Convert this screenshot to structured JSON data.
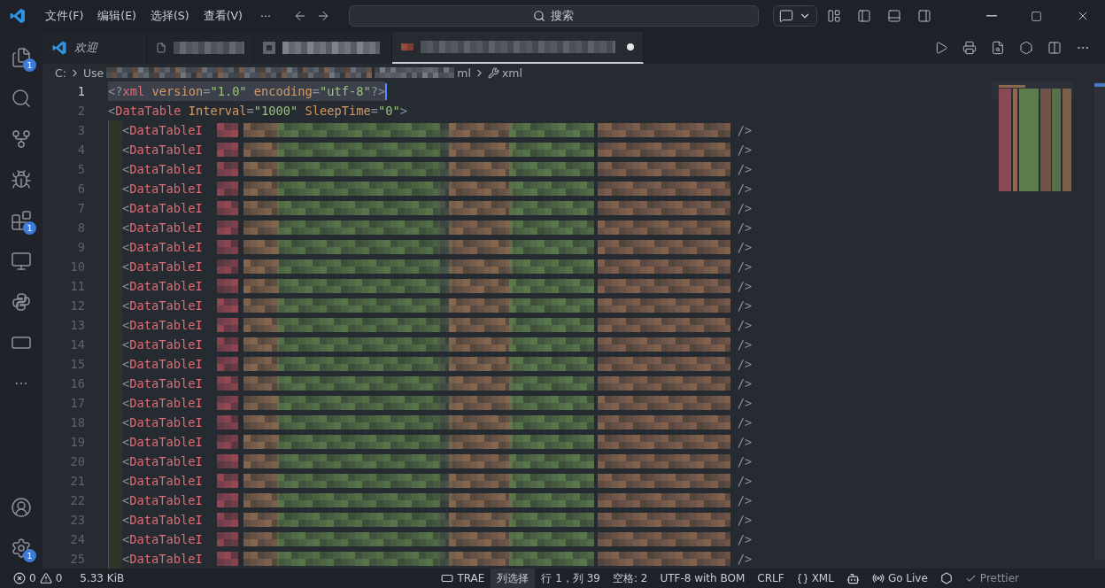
{
  "title_bar": {
    "menus": [
      "文件(F)",
      "编辑(E)",
      "选择(S)",
      "查看(V)"
    ],
    "overflow": "···",
    "command_center": "搜索"
  },
  "activity_bar": {
    "items": [
      {
        "kind": "explorer",
        "badge": "1"
      },
      {
        "kind": "search"
      },
      {
        "kind": "source_control"
      },
      {
        "kind": "debug"
      },
      {
        "kind": "extensions",
        "badge": "1"
      },
      {
        "kind": "remote"
      },
      {
        "kind": "python"
      },
      {
        "kind": "trae"
      },
      {
        "kind": "more",
        "label": "···"
      }
    ],
    "bottom": [
      {
        "kind": "account"
      },
      {
        "kind": "settings",
        "badge": "1"
      }
    ]
  },
  "tabs": [
    {
      "label": "欢迎",
      "selected": false,
      "modified": false
    },
    {
      "selected": false,
      "modified": false
    },
    {
      "selected": false,
      "modified": false
    },
    {
      "selected": true,
      "modified": true
    }
  ],
  "breadcrumb": [
    {
      "text": "C:",
      "kind": "plain"
    },
    {
      "text": "Use",
      "kind": "redacted_head"
    },
    {
      "text": "ml",
      "kind": "redacted_tail"
    },
    {
      "text": "xml",
      "kind": "symbol"
    }
  ],
  "editor": {
    "lines": [
      {
        "number": "1",
        "current": true,
        "tokens": [
          {
            "t": "<?",
            "kind": "punct"
          },
          {
            "t": "xml",
            "kind": "tag"
          },
          {
            "t": " version",
            "kind": "attr"
          },
          {
            "t": "=",
            "kind": "punct"
          },
          {
            "t": "\"1.0\"",
            "kind": "string"
          },
          {
            "t": " encoding",
            "kind": "attr"
          },
          {
            "t": "=",
            "kind": "punct"
          },
          {
            "t": "\"utf-8\"",
            "kind": "string"
          },
          {
            "t": "?>",
            "kind": "punct"
          }
        ]
      },
      {
        "number": "2",
        "current": false,
        "tokens": [
          {
            "t": "<",
            "kind": "punct"
          },
          {
            "t": "DataTable",
            "kind": "tag"
          },
          {
            "t": " Interval",
            "kind": "attr"
          },
          {
            "t": "=",
            "kind": "punct"
          },
          {
            "t": "\"1000\"",
            "kind": "string"
          },
          {
            "t": " SleepTime",
            "kind": "attr"
          },
          {
            "t": "=",
            "kind": "punct"
          },
          {
            "t": "\"0\"",
            "kind": "string"
          },
          {
            "t": ">",
            "kind": "punct"
          }
        ]
      },
      {
        "number": "3",
        "current": false,
        "item": {
          "open": "<",
          "tag": "DataTableI",
          "close": "/>"
        }
      },
      {
        "number": "4",
        "current": false,
        "item": {
          "open": "<",
          "tag": "DataTableI",
          "close": "/>"
        }
      },
      {
        "number": "5",
        "current": false,
        "item": {
          "open": "<",
          "tag": "DataTableI",
          "close": "/>"
        }
      },
      {
        "number": "6",
        "current": false,
        "item": {
          "open": "<",
          "tag": "DataTableI",
          "close": "/>"
        }
      },
      {
        "number": "7",
        "current": false,
        "item": {
          "open": "<",
          "tag": "DataTableI",
          "close": "/>"
        }
      },
      {
        "number": "8",
        "current": false,
        "item": {
          "open": "<",
          "tag": "DataTableI",
          "close": "/>"
        }
      },
      {
        "number": "9",
        "current": false,
        "item": {
          "open": "<",
          "tag": "DataTableI",
          "close": "/>"
        }
      },
      {
        "number": "10",
        "current": false,
        "item": {
          "open": "<",
          "tag": "DataTableI",
          "close": "/>"
        }
      },
      {
        "number": "11",
        "current": false,
        "item": {
          "open": "<",
          "tag": "DataTableI",
          "close": "/>"
        }
      },
      {
        "number": "12",
        "current": false,
        "item": {
          "open": "<",
          "tag": "DataTableI",
          "close": "/>"
        }
      },
      {
        "number": "13",
        "current": false,
        "item": {
          "open": "<",
          "tag": "DataTableI",
          "close": "/>"
        }
      },
      {
        "number": "14",
        "current": false,
        "item": {
          "open": "<",
          "tag": "DataTableI",
          "close": "/>"
        }
      },
      {
        "number": "15",
        "current": false,
        "item": {
          "open": "<",
          "tag": "DataTableI",
          "close": "/>"
        }
      },
      {
        "number": "16",
        "current": false,
        "item": {
          "open": "<",
          "tag": "DataTableI",
          "close": "/>"
        }
      },
      {
        "number": "17",
        "current": false,
        "item": {
          "open": "<",
          "tag": "DataTableI",
          "close": "/>"
        }
      },
      {
        "number": "18",
        "current": false,
        "item": {
          "open": "<",
          "tag": "DataTableI",
          "close": "/>"
        }
      },
      {
        "number": "19",
        "current": false,
        "item": {
          "open": "<",
          "tag": "DataTableI",
          "close": "/>"
        }
      },
      {
        "number": "20",
        "current": false,
        "item": {
          "open": "<",
          "tag": "DataTableI",
          "close": "/>"
        }
      },
      {
        "number": "21",
        "current": false,
        "item": {
          "open": "<",
          "tag": "DataTableI",
          "close": "/>"
        }
      },
      {
        "number": "22",
        "current": false,
        "item": {
          "open": "<",
          "tag": "DataTableI",
          "close": "/>"
        }
      },
      {
        "number": "23",
        "current": false,
        "item": {
          "open": "<",
          "tag": "DataTableI",
          "close": "/>"
        }
      },
      {
        "number": "24",
        "current": false,
        "item": {
          "open": "<",
          "tag": "DataTableI",
          "close": "/>"
        }
      },
      {
        "number": "25",
        "current": false,
        "item": {
          "open": "<",
          "tag": "DataTableI",
          "close": "/>"
        }
      }
    ]
  },
  "status_bar": {
    "errors": "0",
    "warnings": "0",
    "size": "5.33 KiB",
    "items": [
      {
        "kind": "trae",
        "label": "TRAE"
      },
      {
        "kind": "highlight",
        "label": "列选择"
      },
      {
        "kind": "plain",
        "label": "行 1，列 39"
      },
      {
        "kind": "plain",
        "label": "空格: 2"
      },
      {
        "kind": "plain",
        "label": "UTF-8 with BOM"
      },
      {
        "kind": "plain",
        "label": "CRLF"
      },
      {
        "kind": "language",
        "label": "XML"
      },
      {
        "kind": "copilot"
      },
      {
        "kind": "live",
        "label": "Go Live"
      },
      {
        "kind": "cube"
      },
      {
        "kind": "prettier",
        "label": "Prettier"
      }
    ]
  }
}
